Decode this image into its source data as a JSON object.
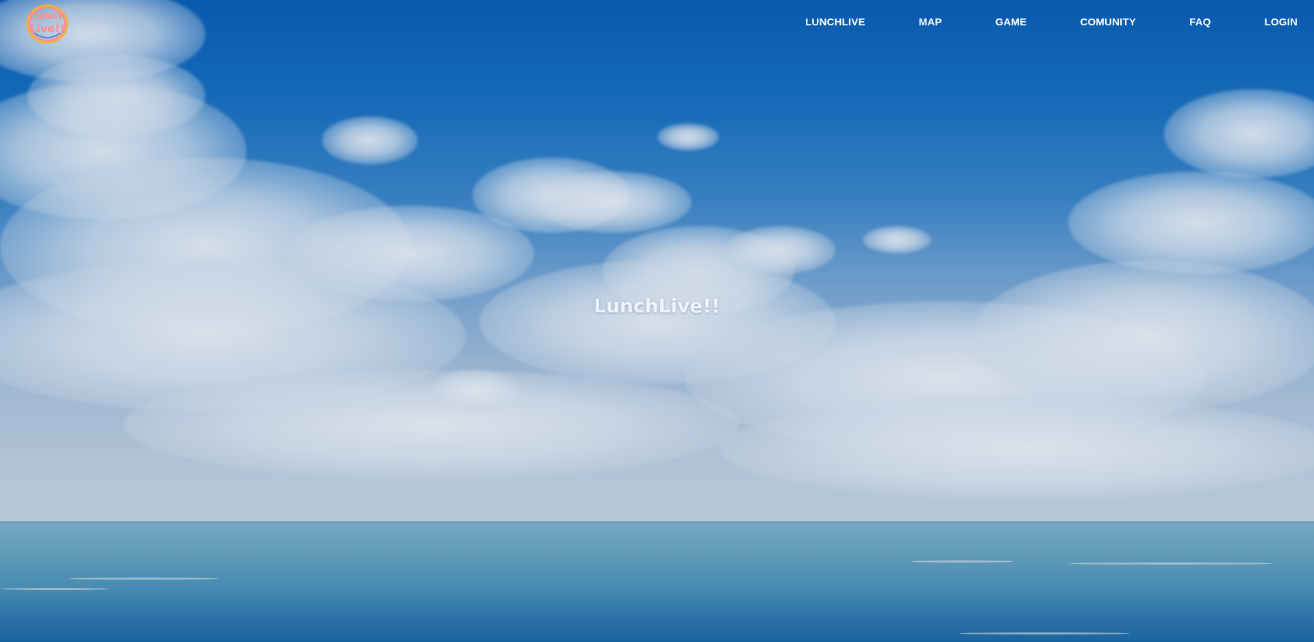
{
  "logo": {
    "line1": "Lunch",
    "line2": "Live!!",
    "primary_color": "#ff8a8a",
    "accent_color": "#f0b23a"
  },
  "nav": {
    "items": [
      {
        "label": "LUNCHLIVE"
      },
      {
        "label": "MAP"
      },
      {
        "label": "GAME"
      },
      {
        "label": "COMUNITY"
      },
      {
        "label": "FAQ"
      },
      {
        "label": "LOGIN"
      }
    ]
  },
  "hero": {
    "title": "LunchLive!!"
  },
  "colors": {
    "nav_text": "#ffffff",
    "sky_top": "#0a5fb8",
    "sea": "#4e94bb"
  }
}
